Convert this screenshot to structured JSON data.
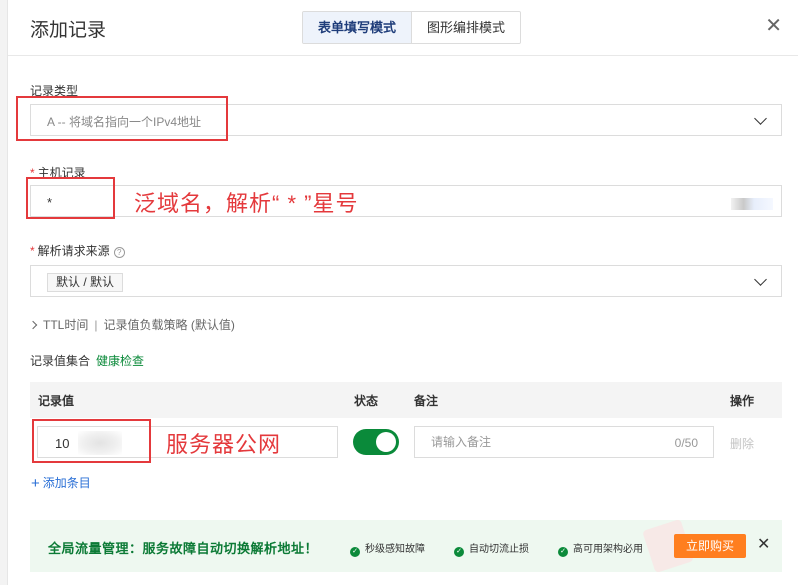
{
  "dialog": {
    "title": "添加记录",
    "tabs": [
      {
        "label": "表单填写模式",
        "active": true
      },
      {
        "label": "图形编排模式",
        "active": false
      }
    ],
    "close_glyph": "✕"
  },
  "record_type": {
    "label": "记录类型",
    "value": "A -- 将域名指向一个IPv4地址"
  },
  "host_record": {
    "required_mark": "*",
    "label": "主机记录",
    "value": "*",
    "annotation": "泛域名，解析“ * ”星号"
  },
  "source": {
    "required_mark": "*",
    "label": "解析请求来源",
    "help_glyph": "?",
    "value": "默认 / 默认"
  },
  "ttl_row": {
    "ttl_label": "TTL时间",
    "separator": "|",
    "lb_label": "记录值负载策略",
    "default_note": "(默认值)"
  },
  "record_set": {
    "label": "记录值集合",
    "health_link": "健康检查"
  },
  "table": {
    "headers": {
      "value": "记录值",
      "status": "状态",
      "remark": "备注",
      "action": "操作"
    },
    "row": {
      "value": "10",
      "status_on": true,
      "remark_placeholder": "请输入备注",
      "remark_count": "0/50",
      "delete_label": "删除"
    },
    "annotation": "服务器公网"
  },
  "add_item": {
    "plus": "+",
    "label": "添加条目"
  },
  "banner": {
    "title": "全局流量管理：服务故障自动切换解析地址！",
    "features": [
      "秒级感知故障",
      "自动切流止损",
      "高可用架构必用"
    ],
    "buy_label": "立即购买",
    "close_glyph": "✕"
  },
  "colors": {
    "accent_blue": "#2a6fd6",
    "success_green": "#0b8a3a",
    "annotation_red": "#e4393c",
    "buy_orange": "#ff7e1f"
  }
}
